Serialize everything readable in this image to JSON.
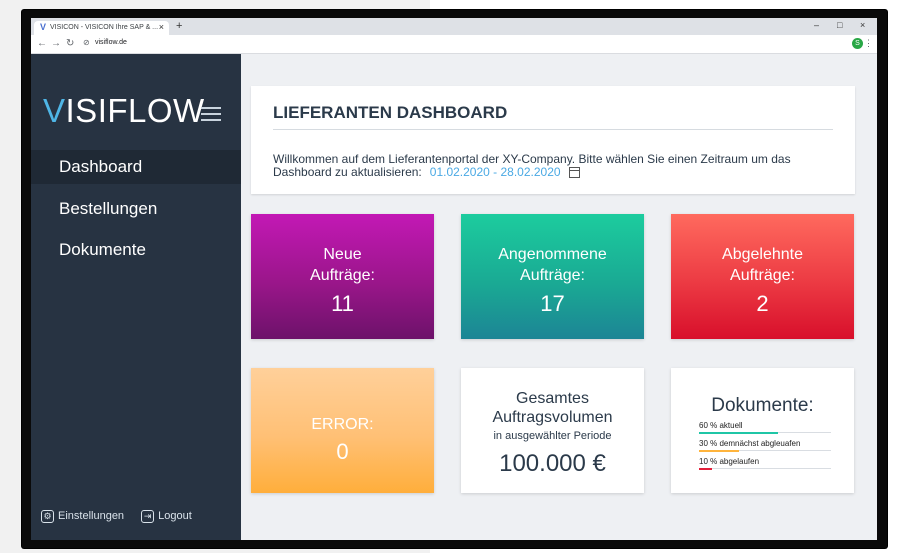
{
  "browser": {
    "tab_title": "VISICON - VISICON Ihre SAP & ...",
    "new_tab": "+",
    "tab_close": "×",
    "url": "visiflow.de",
    "profile_initial": "S",
    "controls": {
      "minimize": "–",
      "maximize": "□",
      "close": "×"
    }
  },
  "sidebar": {
    "logo_v": "V",
    "logo_rest": "ISIFLOW",
    "items": [
      {
        "label": "Dashboard",
        "active": true
      },
      {
        "label": "Bestellungen",
        "active": false
      },
      {
        "label": "Dokumente",
        "active": false
      }
    ],
    "footer": {
      "settings": "Einstellungen",
      "logout": "Logout"
    }
  },
  "header": {
    "title": "LIEFERANTEN DASHBOARD",
    "intro": "Willkommen auf dem Lieferantenportal der XY-Company. Bitte wählen Sie einen Zeitraum um das Dashboard zu aktualisieren:",
    "date_range": "01.02.2020 - 28.02.2020"
  },
  "tiles": {
    "new_orders": {
      "label_1": "Neue",
      "label_2": "Aufträge:",
      "value": "11"
    },
    "accepted_orders": {
      "label_1": "Angenommene",
      "label_2": "Aufträge:",
      "value": "17"
    },
    "rejected_orders": {
      "label_1": "Abgelehnte",
      "label_2": "Aufträge:",
      "value": "2"
    },
    "error": {
      "label": "ERROR:",
      "value": "0"
    },
    "volume": {
      "title_1": "Gesamtes",
      "title_2": "Auftragsvolumen",
      "subtitle": "in ausgewählter Periode",
      "value": "100.000 €"
    },
    "documents": {
      "title": "Dokumente:",
      "rows": [
        {
          "label": "60 % aktuell",
          "percent": 60,
          "color": "#1fc6a6"
        },
        {
          "label": "30 % demnächst abgleuafen",
          "percent": 30,
          "color": "#ffb43c"
        },
        {
          "label": "10 % abgelaufen",
          "percent": 10,
          "color": "#e3203a"
        }
      ]
    }
  }
}
